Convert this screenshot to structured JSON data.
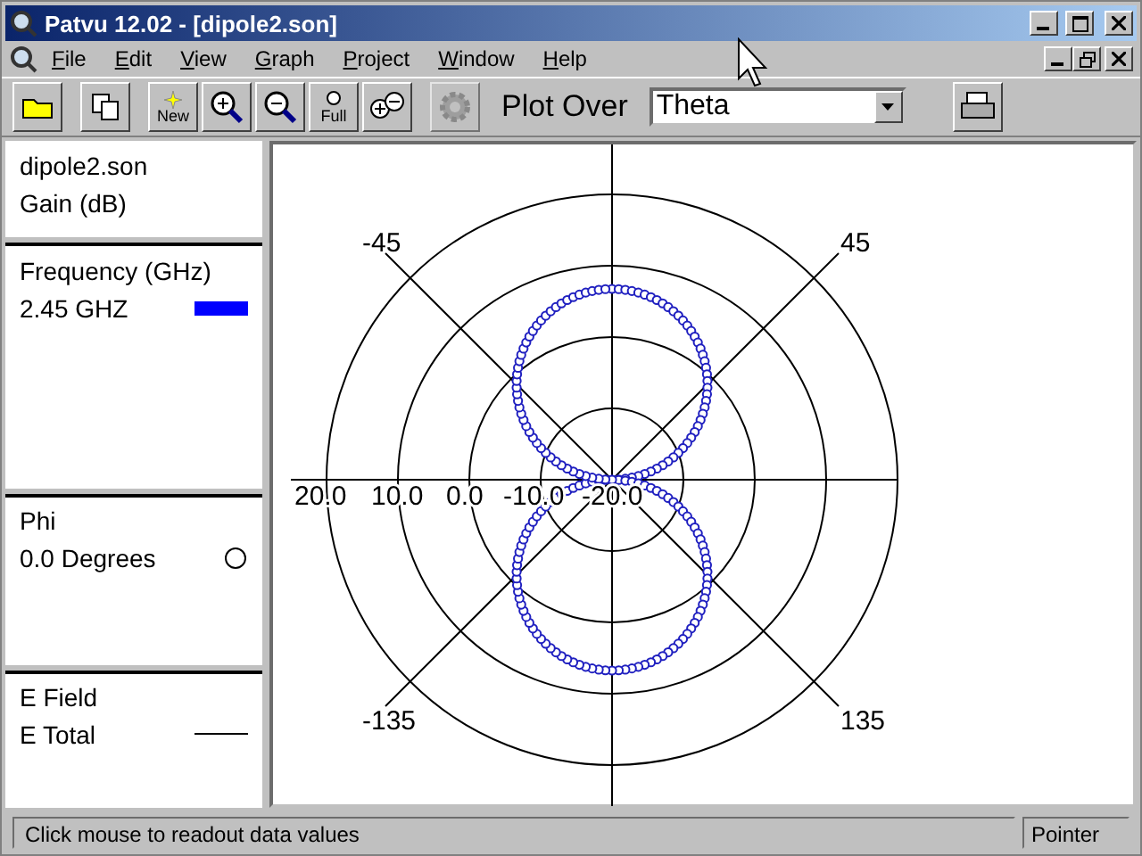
{
  "window": {
    "title": "Patvu 12.02 - [dipole2.son]"
  },
  "menu": [
    "File",
    "Edit",
    "View",
    "Graph",
    "Project",
    "Window",
    "Help"
  ],
  "toolbar": {
    "buttons": [
      {
        "kind": "open",
        "disabled": false
      },
      {
        "kind": "copy",
        "disabled": false
      },
      {
        "kind": "new",
        "label": "New",
        "disabled": false
      },
      {
        "kind": "zoom-in",
        "disabled": false
      },
      {
        "kind": "zoom-out",
        "disabled": false
      },
      {
        "kind": "full",
        "label": "Full",
        "disabled": false
      },
      {
        "kind": "zoom-both",
        "disabled": false
      },
      {
        "kind": "gear",
        "disabled": true
      }
    ],
    "plot_over": {
      "label": "Plot Over",
      "value": "Theta"
    }
  },
  "panel": {
    "sections": [
      {
        "lines": [
          {
            "text": "dipole2.son",
            "kind": "text"
          },
          {
            "text": "Gain (dB)",
            "kind": "text"
          }
        ]
      },
      {
        "lines": [
          {
            "text": "Frequency (GHz)",
            "kind": "text"
          },
          {
            "text": "2.45 GHZ",
            "kind": "swatch"
          }
        ]
      },
      {
        "lines": [
          {
            "text": "Phi",
            "kind": "text"
          },
          {
            "text": "0.0 Degrees",
            "kind": "circle"
          }
        ]
      },
      {
        "lines": [
          {
            "text": "E Field",
            "kind": "text"
          },
          {
            "text": "E Total",
            "kind": "line"
          }
        ]
      }
    ]
  },
  "plot": {
    "ring_labels": [
      "20.0",
      "10.0",
      "0.0",
      "-10.0",
      "-20.0"
    ],
    "angle_labels": [
      "-45",
      "45",
      "-135",
      "135"
    ]
  },
  "status_bar": {
    "message": "Click mouse to readout data values",
    "mode": "Pointer"
  }
}
